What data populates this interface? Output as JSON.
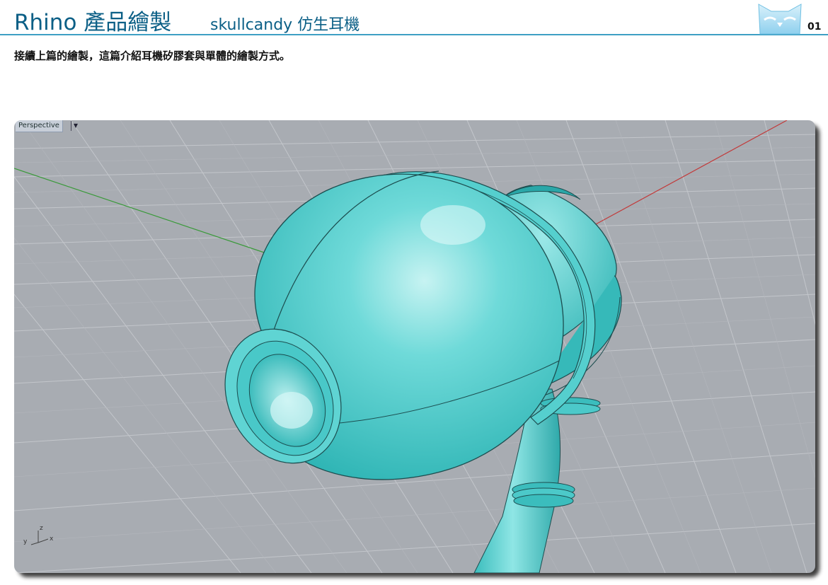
{
  "header": {
    "title": "Rhino 產品繪製",
    "subtitle": "skullcandy 仿生耳機",
    "page_number": "01"
  },
  "intro_text": "接續上篇的繪製，這篇介紹耳機矽膠套與單體的繪製方式。",
  "viewport": {
    "label": "Perspective",
    "menu_icon": "dropdown-arrow",
    "axis_labels": {
      "x": "x",
      "y": "y",
      "z": "z"
    }
  },
  "colors": {
    "brand": "#0b5f86",
    "rule": "#3e9fc4",
    "viewport_bg": "#a8acb2",
    "model": "#4fd0cf"
  }
}
